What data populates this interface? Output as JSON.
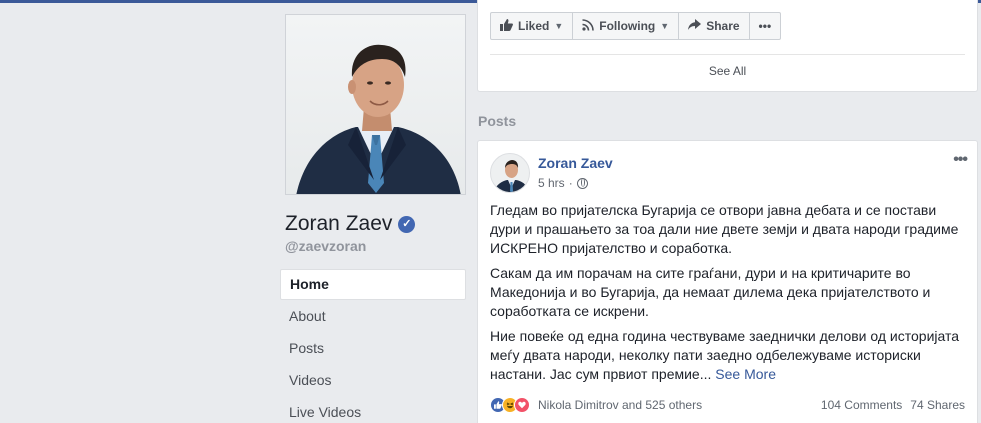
{
  "page": {
    "name": "Zoran Zaev",
    "handle": "@zaevzoran"
  },
  "nav": {
    "items": [
      "Home",
      "About",
      "Posts",
      "Videos",
      "Live Videos"
    ]
  },
  "actions": {
    "liked": "Liked",
    "following": "Following",
    "share": "Share",
    "more": "•••"
  },
  "see_all": "See All",
  "posts_heading": "Posts",
  "post": {
    "author": "Zoran Zaev",
    "time": "5 hrs",
    "options": "•••",
    "paragraphs": [
      "Гледам во пријателска Бугарија се отвори јавна дебата и се постави дури и прашањето за тоа дали ние двете земји и двата народи градиме ИСКРЕНО пријателство и соработка.",
      "Сакам да им порачам на сите граѓани, дури и на критичарите во Македонија и во Бугарија, да немаат дилема дека пријателството и соработката се искрени.",
      "Ние повеќе од една година чествуваме заеднички делови од историјата меѓу двата народи, неколку пати заедно одбележуваме историски настани. Јас сум првиот премие..."
    ],
    "see_more": "See More",
    "reactors": "Nikola Dimitrov and 525 others",
    "comments": "104 Comments",
    "shares": "74 Shares"
  },
  "colors": {
    "background": "#e9ebee",
    "link": "#365899",
    "verified": "#4267b2"
  }
}
